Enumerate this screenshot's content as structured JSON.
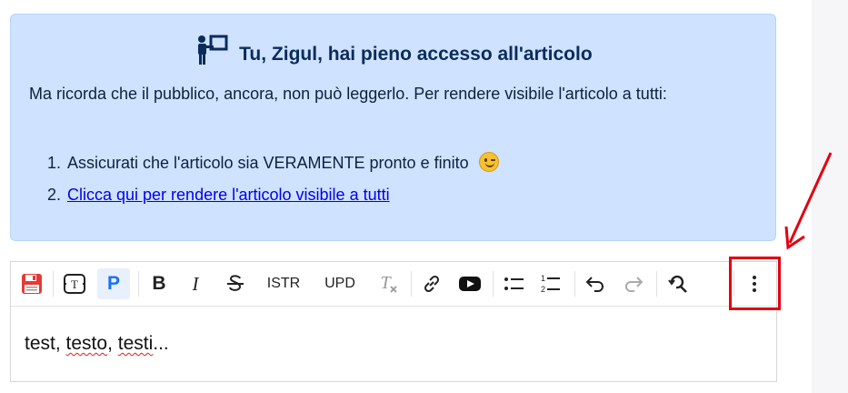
{
  "notice": {
    "title": "Tu, Zigul, hai pieno accesso all'articolo",
    "text": "Ma ricorda che il pubblico, ancora, non può leggerlo. Per rendere visibile l'articolo a tutti:",
    "steps": [
      "Assicurati che l'articolo sia VERAMENTE pronto e finito",
      "Clicca qui per rendere l'articolo visibile a tutti"
    ],
    "icon": "presenter-board-icon"
  },
  "toolbar": {
    "save": "save-icon",
    "template": "template-icon",
    "paragraph_label": "P",
    "bold_label": "B",
    "italic_label": "I",
    "strike": "strikethrough-icon",
    "istr_label": "ISTR",
    "upd_label": "UPD",
    "clear_format": "clear-format-icon",
    "link": "link-icon",
    "video": "youtube-icon",
    "bullet_list": "bullet-list-icon",
    "numbered_list": "numbered-list-icon",
    "undo": "undo-icon",
    "redo": "redo-icon",
    "find_replace": "find-replace-icon",
    "more": "more-vertical-icon"
  },
  "editor": {
    "content_prefix": "test, ",
    "content_word1": "testo",
    "content_sep": ", ",
    "content_word2": "testi",
    "content_suffix": "..."
  },
  "colors": {
    "notice_bg": "#cfe2ff",
    "annotation": "#e3000f",
    "accent": "#1a73e8"
  }
}
